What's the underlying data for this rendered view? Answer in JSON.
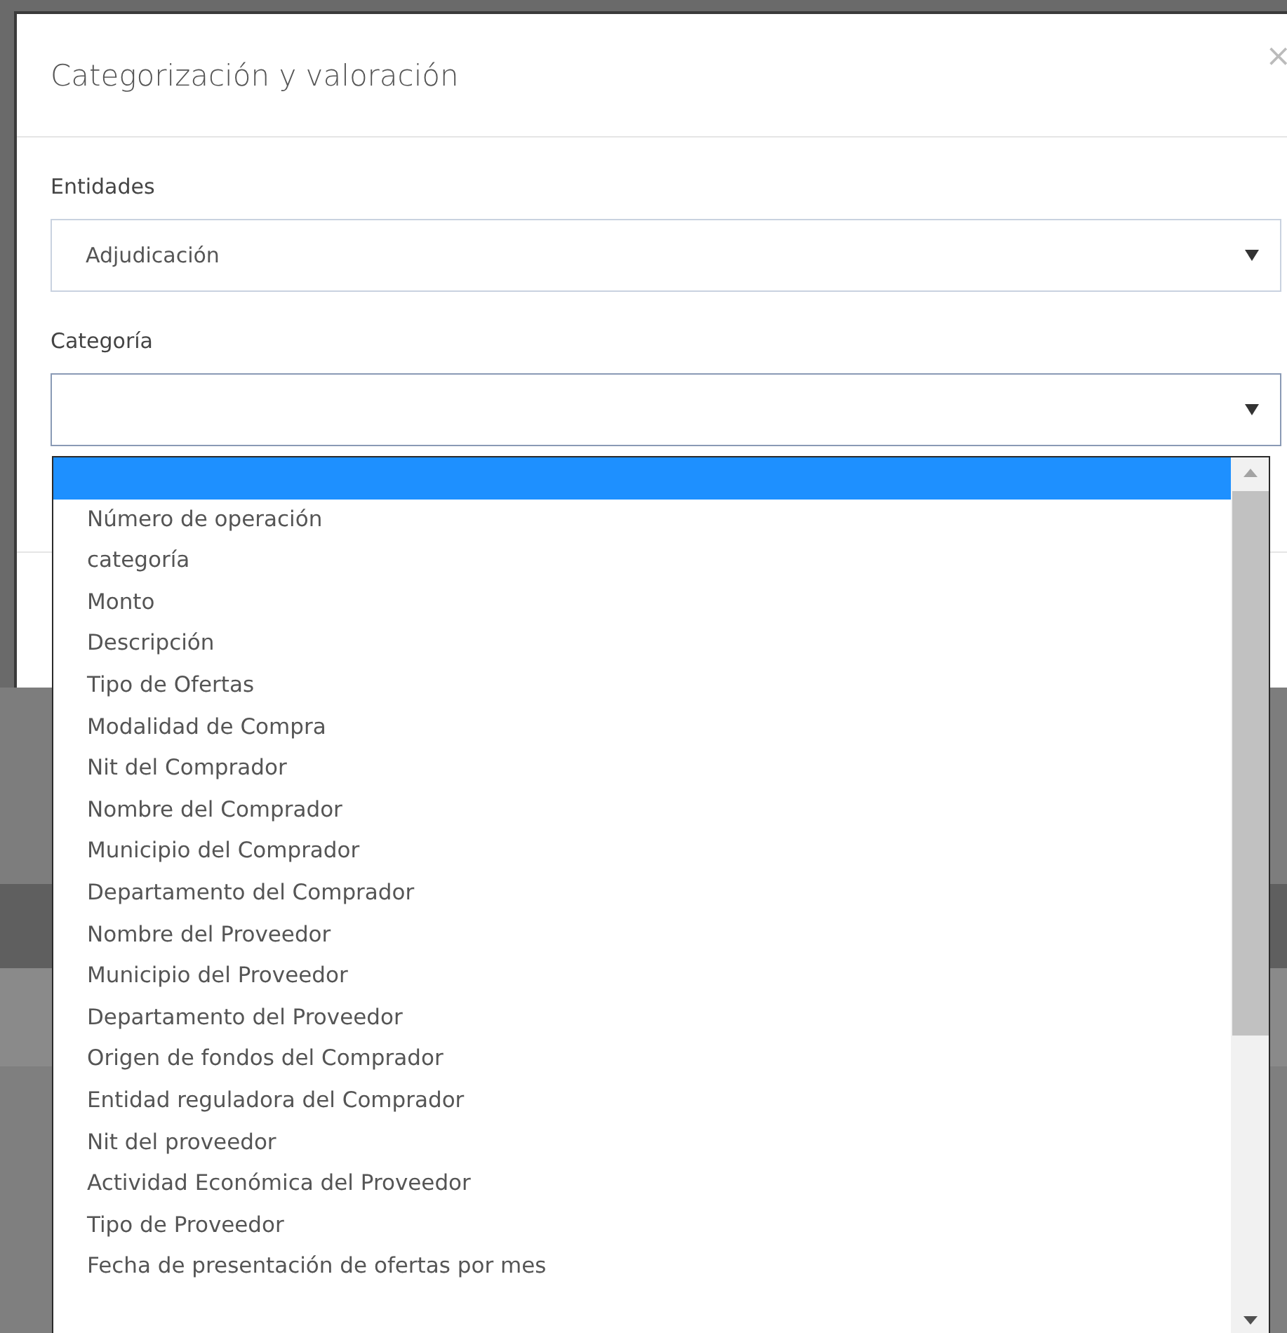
{
  "dialog": {
    "title": "Categorización y valoración",
    "close": "×",
    "fields": [
      {
        "label": "Entidades",
        "value": "Adjudicación",
        "open": false
      },
      {
        "label": "Categoría",
        "open": true
      }
    ]
  },
  "dropdown": {
    "options": [
      {
        "selected": true
      },
      {
        "label": "Número de operación",
        "selected": false
      },
      {
        "label": "categoría",
        "selected": false
      },
      {
        "label": "Monto",
        "selected": false
      },
      {
        "label": "Descripción",
        "selected": false
      },
      {
        "label": "Tipo de Ofertas",
        "selected": false
      },
      {
        "label": "Modalidad de Compra",
        "selected": false
      },
      {
        "label": "Nit del Comprador",
        "selected": false
      },
      {
        "label": "Nombre del Comprador",
        "selected": false
      },
      {
        "label": "Municipio del Comprador",
        "selected": false
      },
      {
        "label": "Departamento del Comprador",
        "selected": false
      },
      {
        "label": "Nombre del Proveedor",
        "selected": false
      },
      {
        "label": "Municipio del Proveedor",
        "selected": false
      },
      {
        "label": "Departamento del Proveedor",
        "selected": false
      },
      {
        "label": "Origen de fondos del Comprador",
        "selected": false
      },
      {
        "label": "Entidad reguladora del Comprador",
        "selected": false
      },
      {
        "label": "Nit del proveedor",
        "selected": false
      },
      {
        "label": "Actividad Económica del Proveedor",
        "selected": false
      },
      {
        "label": "Tipo de Proveedor",
        "selected": false
      },
      {
        "label": "Fecha de presentación de ofertas por mes",
        "selected": false
      }
    ]
  }
}
